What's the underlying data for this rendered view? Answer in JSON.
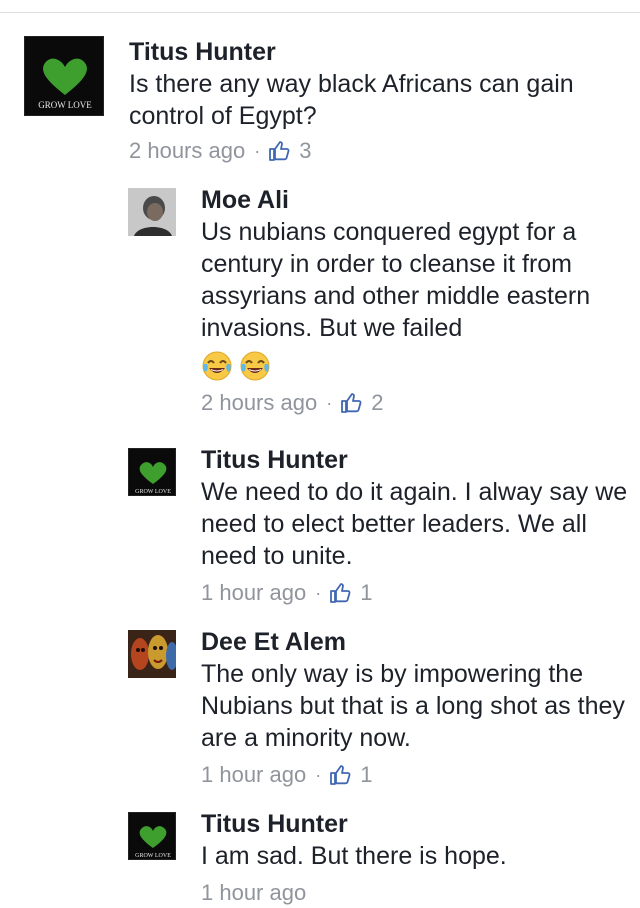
{
  "comments": [
    {
      "author": "Titus Hunter",
      "text": "Is there any way black Africans can gain control of Egypt?",
      "time": "2 hours ago",
      "likes": "3",
      "avatar": "grow-love-avatar",
      "avatar_text": "GROW LOVE"
    },
    {
      "author": "Moe Ali",
      "text": "Us nubians conquered egypt for a century in order to cleanse it from assyrians and other middle eastern invasions. But we failed",
      "emojis": [
        "tears-of-joy-emoji",
        "tears-of-joy-emoji"
      ],
      "time": "2 hours ago",
      "likes": "2",
      "avatar": "photo-avatar"
    },
    {
      "author": "Titus Hunter",
      "text": "We need to do it again. I alway say  we need to elect better leaders. We all need to unite.",
      "time": "1 hour ago",
      "likes": "1",
      "avatar": "grow-love-avatar",
      "avatar_text": "GROW LOVE"
    },
    {
      "author": "Dee Et Alem",
      "text": "The only way is by impowering the Nubians but that is a long shot as they are a minority now.",
      "time": "1 hour ago",
      "likes": "1",
      "avatar": "masks-avatar"
    },
    {
      "author": "Titus Hunter",
      "text": "I am sad. But there is hope.",
      "time": "1 hour ago",
      "avatar": "grow-love-avatar",
      "avatar_text": "GROW LOVE"
    }
  ],
  "separator": "·",
  "colors": {
    "text": "#1d2129",
    "meta": "#90949c",
    "like_icon": "#4267b2"
  }
}
